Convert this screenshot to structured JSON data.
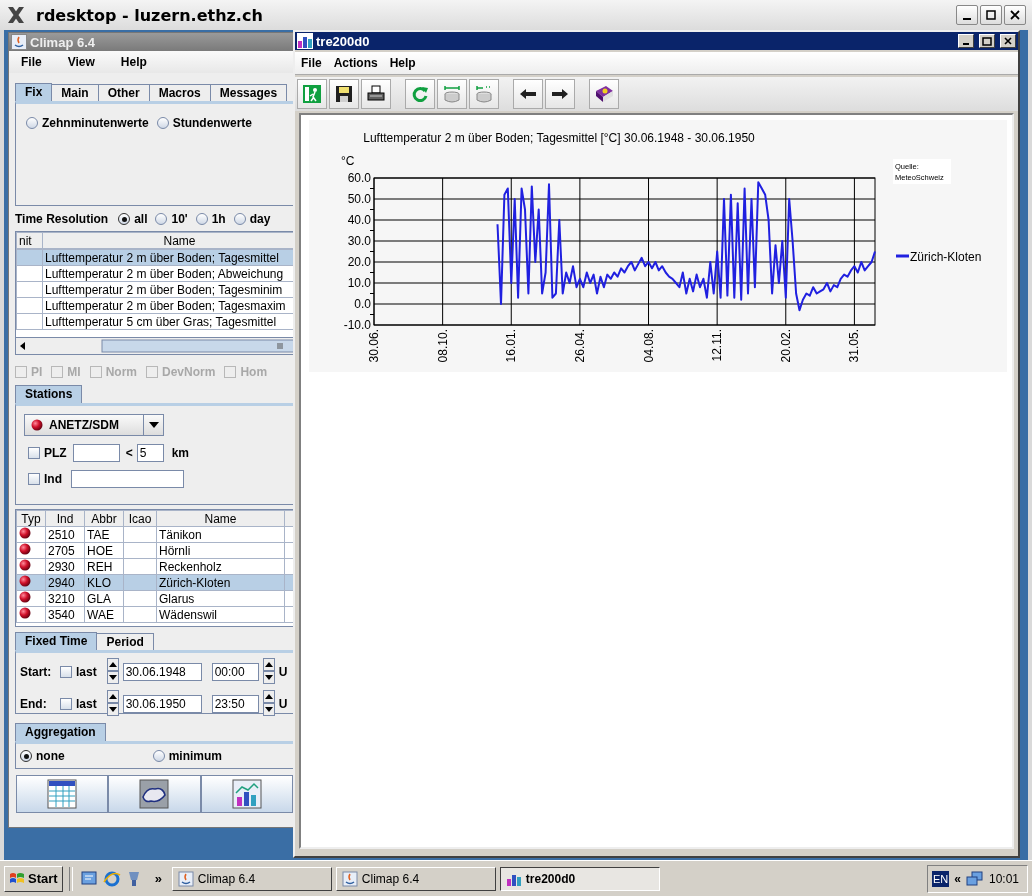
{
  "window": {
    "title": "rdesktop - luzern.ethz.ch"
  },
  "climap": {
    "title": "Climap 6.4",
    "menu": [
      "File",
      "View",
      "Help"
    ],
    "tabs": [
      {
        "label": "Fix",
        "selected": true
      },
      {
        "label": "Main",
        "selected": false
      },
      {
        "label": "Other",
        "selected": false
      },
      {
        "label": "Macros",
        "selected": false
      },
      {
        "label": "Messages",
        "selected": false
      }
    ],
    "fix_options": [
      {
        "label": "Zehnminutenwerte",
        "selected": false
      },
      {
        "label": "Stundenwerte",
        "selected": false
      }
    ],
    "time_resolution": {
      "label": "Time Resolution",
      "options": [
        {
          "label": "all",
          "selected": true
        },
        {
          "label": "10'",
          "selected": false
        },
        {
          "label": "1h",
          "selected": false
        },
        {
          "label": "day",
          "selected": false
        }
      ]
    },
    "parameter_table": {
      "columns": [
        "nit",
        "Name"
      ],
      "rows": [
        {
          "name": "Lufttemperatur 2 m über Boden; Tagesmittel",
          "selected": true
        },
        {
          "name": "Lufttemperatur 2 m über Boden; Abweichung",
          "selected": false
        },
        {
          "name": "Lufttemperatur 2 m über Boden; Tagesminim",
          "selected": false
        },
        {
          "name": "Lufttemperatur 2 m über Boden; Tagesmaxim",
          "selected": false
        },
        {
          "name": "Lufttemperatur 5 cm über Gras; Tagesmittel",
          "selected": false
        }
      ]
    },
    "flags": [
      {
        "label": "PI",
        "checked": false,
        "disabled": true
      },
      {
        "label": "MI",
        "checked": false,
        "disabled": true
      },
      {
        "label": "Norm",
        "checked": false,
        "disabled": true
      },
      {
        "label": "DevNorm",
        "checked": false,
        "disabled": true
      },
      {
        "label": "Hom",
        "checked": false,
        "disabled": true
      }
    ],
    "stations": {
      "tabs": [
        {
          "label": "Stations",
          "selected": true
        }
      ],
      "network": "ANETZ/SDM",
      "plz": {
        "label": "PLZ",
        "checked": false,
        "operator": "<",
        "radius": "5",
        "unit": "km"
      },
      "ind": {
        "label": "Ind",
        "checked": false
      },
      "table": {
        "columns": [
          "Typ",
          "Ind",
          "Abbr",
          "Icao",
          "Name"
        ],
        "rows": [
          {
            "ind": "2510",
            "abbr": "TAE",
            "name": "Tänikon",
            "selected": false
          },
          {
            "ind": "2705",
            "abbr": "HOE",
            "name": "Hörnli",
            "selected": false
          },
          {
            "ind": "2930",
            "abbr": "REH",
            "name": "Reckenholz",
            "selected": false
          },
          {
            "ind": "2940",
            "abbr": "KLO",
            "name": "Zürich-Kloten",
            "selected": true
          },
          {
            "ind": "3210",
            "abbr": "GLA",
            "name": "Glarus",
            "selected": false
          },
          {
            "ind": "3540",
            "abbr": "WAE",
            "name": "Wädenswil",
            "selected": false
          }
        ]
      }
    },
    "time_tabs": [
      {
        "label": "Fixed Time",
        "selected": true
      },
      {
        "label": "Period",
        "selected": false
      }
    ],
    "time_rows": [
      {
        "label": "Start:",
        "last_label": "last",
        "last_checked": false,
        "date": "30.06.1948",
        "time": "00:00",
        "unit": "U"
      },
      {
        "label": "End:",
        "last_label": "last",
        "last_checked": false,
        "date": "30.06.1950",
        "time": "23:50",
        "unit": "U"
      }
    ],
    "aggregation": {
      "tabs": [
        {
          "label": "Aggregation",
          "selected": true
        }
      ],
      "options": [
        {
          "label": "none",
          "selected": true
        },
        {
          "label": "minimum",
          "selected": false
        }
      ]
    }
  },
  "chart_window": {
    "title": "tre200d0",
    "menu": [
      "File",
      "Actions",
      "Help"
    ],
    "source_note": [
      "Quelle:",
      "MeteoSchweiz"
    ],
    "chart_data": {
      "type": "line",
      "grid": true,
      "title": "Lufttemperatur 2 m über Boden; Tagesmittel [°C] 30.06.1948 - 30.06.1950",
      "ylabel": "°C",
      "ylim": [
        -10,
        60
      ],
      "yticks": [
        {
          "value": 60,
          "label": "60.0"
        },
        {
          "value": 50,
          "label": "50.0"
        },
        {
          "value": 40,
          "label": "40.0"
        },
        {
          "value": 30,
          "label": "30.0"
        },
        {
          "value": 20,
          "label": "20.0"
        },
        {
          "value": 10,
          "label": "10.0"
        },
        {
          "value": 0,
          "label": "0.0"
        },
        {
          "value": -10,
          "label": "-10.0"
        }
      ],
      "categories": [
        "30.06.",
        null,
        null,
        null,
        null,
        null,
        null,
        null,
        null,
        null,
        null,
        null,
        null,
        null,
        null,
        null,
        null,
        null,
        null,
        null,
        "08.10.",
        null,
        null,
        null,
        null,
        null,
        null,
        null,
        null,
        null,
        null,
        null,
        null,
        null,
        null,
        null,
        null,
        null,
        null,
        null,
        "16.01.",
        null,
        null,
        null,
        null,
        null,
        null,
        null,
        null,
        null,
        null,
        null,
        null,
        null,
        null,
        null,
        null,
        null,
        null,
        null,
        "26.04.",
        null,
        null,
        null,
        null,
        null,
        null,
        null,
        null,
        null,
        null,
        null,
        null,
        null,
        null,
        null,
        null,
        null,
        null,
        null,
        "04.08.",
        null,
        null,
        null,
        null,
        null,
        null,
        null,
        null,
        null,
        null,
        null,
        null,
        null,
        null,
        null,
        null,
        null,
        null,
        null,
        "12.11.",
        null,
        null,
        null,
        null,
        null,
        null,
        null,
        null,
        null,
        null,
        null,
        null,
        null,
        null,
        null,
        null,
        null,
        null,
        null,
        "20.02.",
        null,
        null,
        null,
        null,
        null,
        null,
        null,
        null,
        null,
        null,
        null,
        null,
        null,
        null,
        null,
        null,
        null,
        null,
        null,
        "31.05.",
        null,
        null,
        null,
        null,
        null,
        null
      ],
      "series": [
        {
          "name": "Zürich-Kloten",
          "color": "#2020e0",
          "values": [
            null,
            null,
            null,
            null,
            null,
            null,
            null,
            null,
            null,
            null,
            null,
            null,
            null,
            null,
            null,
            null,
            null,
            null,
            null,
            null,
            null,
            null,
            null,
            null,
            null,
            null,
            null,
            null,
            null,
            null,
            null,
            null,
            null,
            null,
            null,
            null,
            38,
            0,
            52,
            55,
            10,
            50,
            3,
            55,
            45,
            5,
            56,
            20,
            45,
            5,
            15,
            57,
            3,
            5,
            40,
            5,
            15,
            10,
            18,
            8,
            12,
            8,
            15,
            10,
            14,
            5,
            13,
            8,
            14,
            12,
            15,
            13,
            17,
            15,
            18,
            20,
            16,
            19,
            22,
            18,
            20,
            17,
            20,
            16,
            18,
            15,
            13,
            12,
            10,
            8,
            15,
            5,
            12,
            6,
            14,
            8,
            12,
            3,
            20,
            5,
            25,
            3,
            50,
            4,
            52,
            3,
            48,
            2,
            55,
            5,
            50,
            8,
            58,
            55,
            52,
            40,
            5,
            28,
            10,
            30,
            3,
            50,
            30,
            5,
            -3,
            2,
            5,
            4,
            8,
            5,
            6,
            7,
            10,
            6,
            9,
            8,
            12,
            14,
            13,
            16,
            18,
            15,
            20,
            16,
            18,
            20,
            25
          ]
        }
      ]
    }
  },
  "taskbar": {
    "start": "Start",
    "more": "»",
    "tasks": [
      {
        "label": "Climap 6.4",
        "selected": false
      },
      {
        "label": "Climap 6.4",
        "selected": false
      },
      {
        "label": "tre200d0",
        "selected": true
      }
    ],
    "language": "EN",
    "expand": "«",
    "clock": "10:01"
  }
}
